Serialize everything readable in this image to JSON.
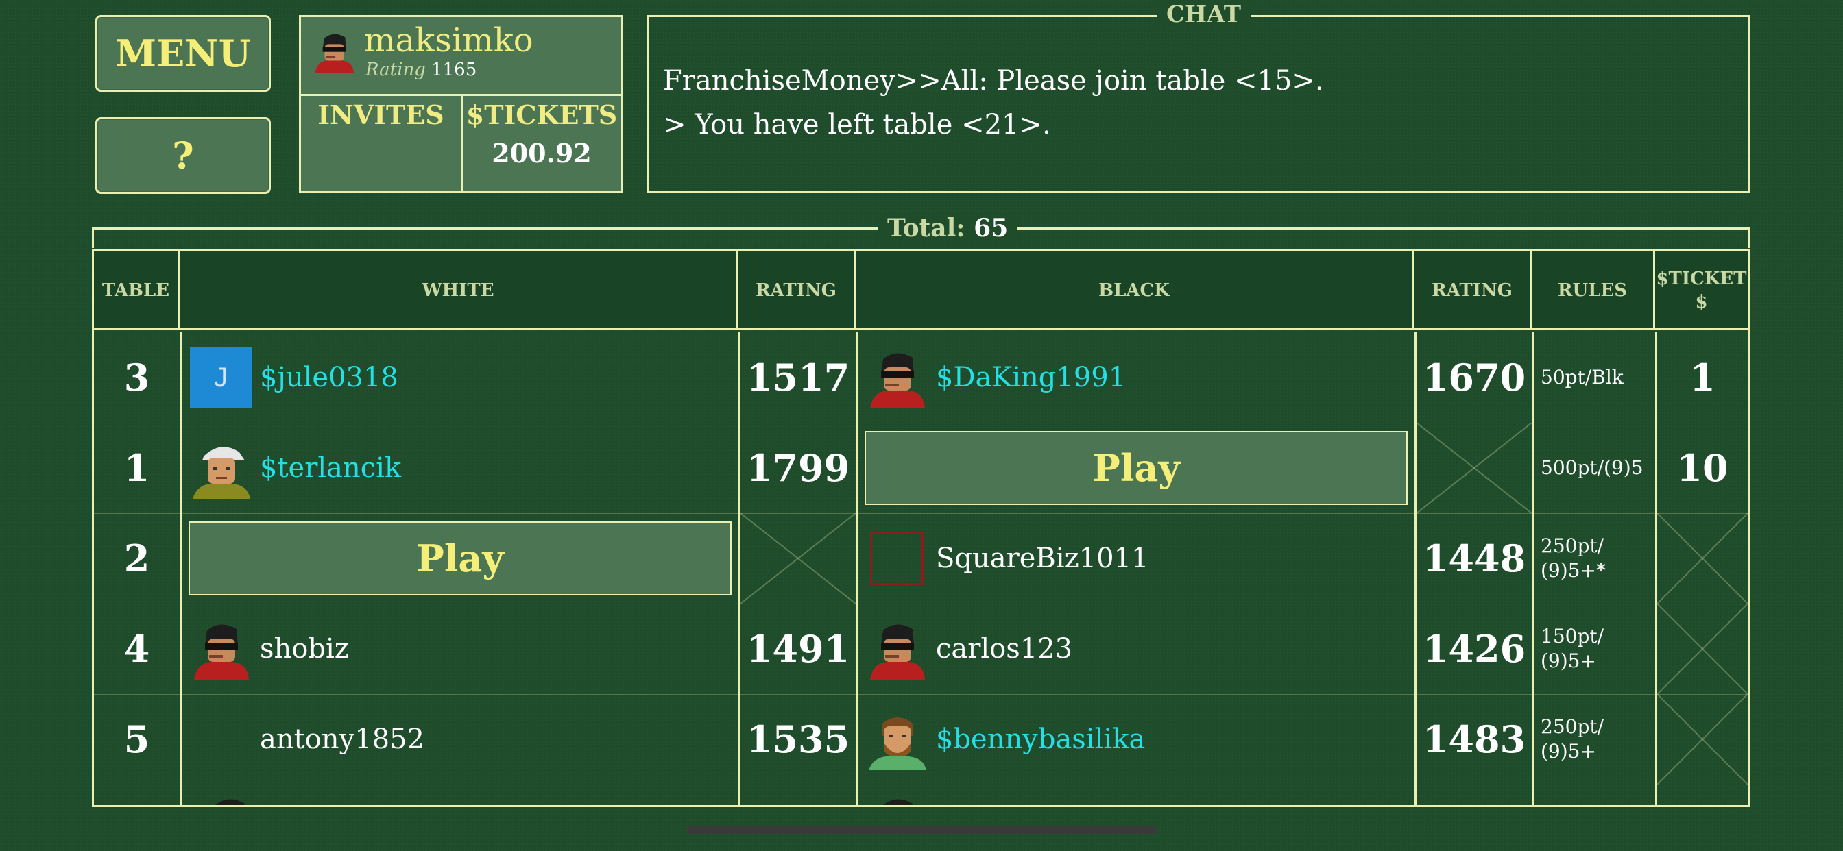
{
  "menu": {
    "menu_label": "MENU",
    "help_label": "?"
  },
  "profile": {
    "username": "maksimko",
    "rating_label": "Rating",
    "rating": "1165",
    "invites_label": "INVITES",
    "tickets_label": "$TICKETS",
    "tickets_value": "200.92"
  },
  "chat": {
    "title": "CHAT",
    "messages": [
      "FranchiseMoney>>All: Please join table <15>.",
      "> You have left table <21>."
    ]
  },
  "tables": {
    "total_label": "Total:",
    "total_value": "65",
    "headers": [
      "TABLE",
      "WHITE",
      "RATING",
      "BLACK",
      "RATING",
      "RULES",
      "$TICKET\n$"
    ],
    "play_label": "Play",
    "rows": [
      {
        "table": "3",
        "white": "$jule0318",
        "white_rating": "1517",
        "black": "$DaKing1991",
        "black_rating": "1670",
        "rules": "50pt/Blk",
        "tickets": "1"
      },
      {
        "table": "1",
        "white": "$terlancik",
        "white_rating": "1799",
        "black": "",
        "black_rating": "",
        "rules": "500pt/(9)5",
        "tickets": "10"
      },
      {
        "table": "2",
        "white": "",
        "white_rating": "",
        "black": "SquareBiz1011",
        "black_rating": "1448",
        "rules": "250pt/\n(9)5+*",
        "tickets": ""
      },
      {
        "table": "4",
        "white": "shobiz",
        "white_rating": "1491",
        "black": "carlos123",
        "black_rating": "1426",
        "rules": "150pt/\n(9)5+",
        "tickets": ""
      },
      {
        "table": "5",
        "white": "antony1852",
        "white_rating": "1535",
        "black": "$bennybasilika",
        "black_rating": "1483",
        "rules": "250pt/\n(9)5+",
        "tickets": ""
      }
    ],
    "avatar_initial": "J"
  },
  "colors": {
    "felt": "#1f4d2c",
    "border": "#eaf0b2",
    "button": "#4c7553",
    "label_yellow": "#f0eb82",
    "ticket_user": "#24e0e6"
  }
}
